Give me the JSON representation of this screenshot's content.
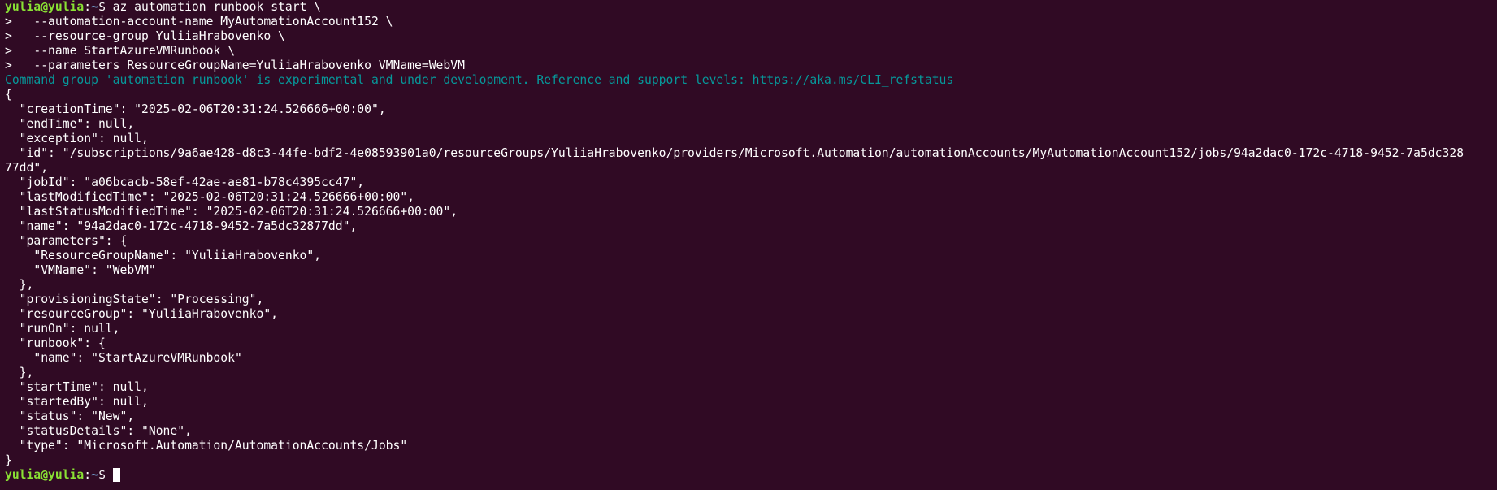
{
  "prompt": {
    "user_host": "yulia@yulia",
    "colon": ":",
    "path": "~",
    "symbol": "$ "
  },
  "command_lines": [
    "az automation runbook start \\",
    ">   --automation-account-name MyAutomationAccount152 \\",
    ">   --resource-group YuliiaHrabovenko \\",
    ">   --name StartAzureVMRunbook \\",
    ">   --parameters ResourceGroupName=YuliiaHrabovenko VMName=WebVM"
  ],
  "warning": "Command group 'automation runbook' is experimental and under development. Reference and support levels: https://aka.ms/CLI_refstatus",
  "output_lines": [
    "{",
    "  \"creationTime\": \"2025-02-06T20:31:24.526666+00:00\",",
    "  \"endTime\": null,",
    "  \"exception\": null,",
    "  \"id\": \"/subscriptions/9a6ae428-d8c3-44fe-bdf2-4e08593901a0/resourceGroups/YuliiaHrabovenko/providers/Microsoft.Automation/automationAccounts/MyAutomationAccount152/jobs/94a2dac0-172c-4718-9452-7a5dc328",
    "77dd\",",
    "  \"jobId\": \"a06bcacb-58ef-42ae-ae81-b78c4395cc47\",",
    "  \"lastModifiedTime\": \"2025-02-06T20:31:24.526666+00:00\",",
    "  \"lastStatusModifiedTime\": \"2025-02-06T20:31:24.526666+00:00\",",
    "  \"name\": \"94a2dac0-172c-4718-9452-7a5dc32877dd\",",
    "  \"parameters\": {",
    "    \"ResourceGroupName\": \"YuliiaHrabovenko\",",
    "    \"VMName\": \"WebVM\"",
    "  },",
    "  \"provisioningState\": \"Processing\",",
    "  \"resourceGroup\": \"YuliiaHrabovenko\",",
    "  \"runOn\": null,",
    "  \"runbook\": {",
    "    \"name\": \"StartAzureVMRunbook\"",
    "  },",
    "  \"startTime\": null,",
    "  \"startedBy\": null,",
    "  \"status\": \"New\",",
    "  \"statusDetails\": \"None\",",
    "  \"type\": \"Microsoft.Automation/AutomationAccounts/Jobs\"",
    "}"
  ],
  "colors": {
    "background": "#300a24",
    "prompt_user": "#8ae234",
    "prompt_path": "#729fcf",
    "warning_text": "#06989a",
    "text": "#ffffff"
  }
}
